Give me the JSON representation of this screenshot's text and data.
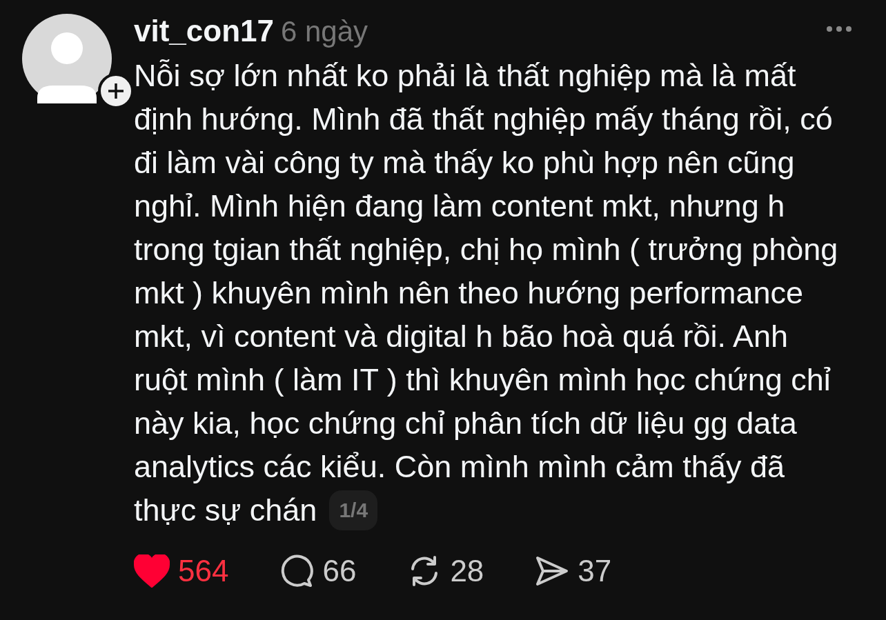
{
  "post": {
    "username": "vit_con17",
    "time": "6 ngày",
    "body": "Nỗi sợ lớn nhất ko phải là thất nghiệp mà là mất\nđịnh hướng. Mình đã thất nghiệp mấy tháng rồi, có\nđi làm vài công ty mà thấy ko phù hợp nên cũng\nnghỉ. Mình hiện đang làm content mkt, nhưng h\ntrong tgian thất nghiệp, chị họ mình ( trưởng phòng\nmkt ) khuyên mình nên theo hướng performance\nmkt, vì content và digital h bão hoà quá rồi. Anh\nruột mình ( làm IT ) thì khuyên mình học chứng chỉ\nnày kia, học chứng chỉ phân tích dữ liệu gg data\nanalytics các kiểu. Còn mình mình cảm thấy đã\nthực sự chán",
    "page_indicator": "1/4",
    "actions": [
      {
        "kind": "like",
        "count": "564",
        "selected": true
      },
      {
        "kind": "comment",
        "count": "66",
        "selected": false
      },
      {
        "kind": "repost",
        "count": "28",
        "selected": false
      },
      {
        "kind": "share",
        "count": "37",
        "selected": false
      }
    ]
  }
}
